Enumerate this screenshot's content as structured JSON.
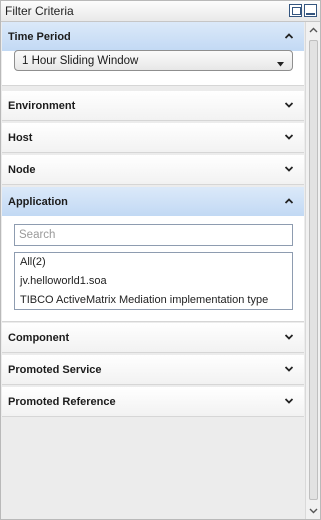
{
  "panel": {
    "title": "Filter Criteria",
    "icons": {
      "restore": "restore-window-icon",
      "maximize": "maximize-window-icon"
    }
  },
  "sections": {
    "time_period": {
      "label": "Time Period",
      "expanded": true,
      "selected_value": "1 Hour Sliding Window"
    },
    "environment": {
      "label": "Environment",
      "expanded": false
    },
    "host": {
      "label": "Host",
      "expanded": false
    },
    "node": {
      "label": "Node",
      "expanded": false
    },
    "application": {
      "label": "Application",
      "expanded": true,
      "search_placeholder": "Search",
      "items": [
        "All(2)",
        "jv.helloworld1.soa",
        "TIBCO ActiveMatrix Mediation implementation type"
      ]
    },
    "component": {
      "label": "Component",
      "expanded": false
    },
    "promoted_service": {
      "label": "Promoted Service",
      "expanded": false
    },
    "promoted_reference": {
      "label": "Promoted Reference",
      "expanded": false
    }
  },
  "colors": {
    "active_header": "#c2d9f4",
    "border": "#8e9cb0",
    "panel_background": "#ececec"
  }
}
